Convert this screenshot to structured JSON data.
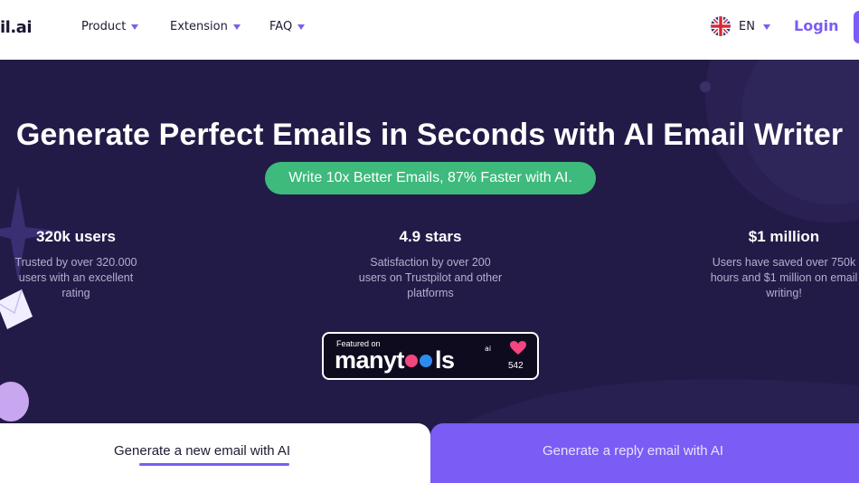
{
  "nav": {
    "logo": "il.ai",
    "items": [
      {
        "label": "Product"
      },
      {
        "label": "Extension"
      },
      {
        "label": "FAQ"
      }
    ],
    "language": "EN",
    "login": "Login"
  },
  "hero": {
    "title": "Generate Perfect Emails in Seconds with AI Email Writer",
    "tagline": "Write 10x Better Emails, 87% Faster with AI.",
    "stats": [
      {
        "value": "320k users",
        "desc_lines": [
          "Trusted by over 320.000",
          "users with an excellent",
          "rating"
        ]
      },
      {
        "value": "4.9 stars",
        "desc_lines": [
          "Satisfaction by over 200",
          "users on Trustpilot and other",
          "platforms"
        ]
      },
      {
        "value": "$1 million",
        "desc_lines": [
          "Users have saved over 750k",
          "hours and $1 million on email",
          "writing!"
        ]
      }
    ],
    "badge": {
      "featured": "Featured on",
      "brand_before": "manyt",
      "brand_after": "ls",
      "suffix": "ai",
      "count": "542"
    }
  },
  "tabs": {
    "new_email": "Generate a new email with AI",
    "reply_email": "Generate a reply email with AI"
  },
  "colors": {
    "accent": "#7b5cf5",
    "hero_bg": "#231b47",
    "pill_green": "#3dba7c",
    "heart": "#f3457f"
  }
}
